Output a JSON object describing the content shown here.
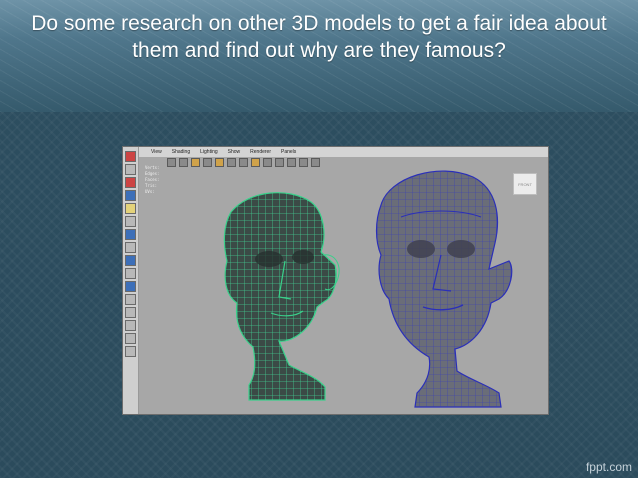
{
  "slide": {
    "title": "Do some research on other 3D models to get a fair idea about them and find out why are they famous?"
  },
  "viewport": {
    "menu": [
      "View",
      "Shading",
      "Lighting",
      "Show",
      "Renderer",
      "Panels"
    ],
    "hud_rows": [
      {
        "label": "Verts:",
        "v1": "",
        "v2": "",
        "v3": ""
      },
      {
        "label": "Edges:",
        "v1": "",
        "v2": "",
        "v3": ""
      },
      {
        "label": "Faces:",
        "v1": "",
        "v2": "",
        "v3": ""
      },
      {
        "label": "Tris:",
        "v1": "",
        "v2": "",
        "v3": ""
      },
      {
        "label": "UVs:",
        "v1": "",
        "v2": "",
        "v3": ""
      }
    ],
    "viewcube_label": "FRONT"
  },
  "colors": {
    "viewport_bg": "#a7a7a7",
    "head_green": "#3bd38f",
    "head_grey": "#6b6e78",
    "wire_blue": "#2a2fb8"
  },
  "watermark": "fppt.com"
}
